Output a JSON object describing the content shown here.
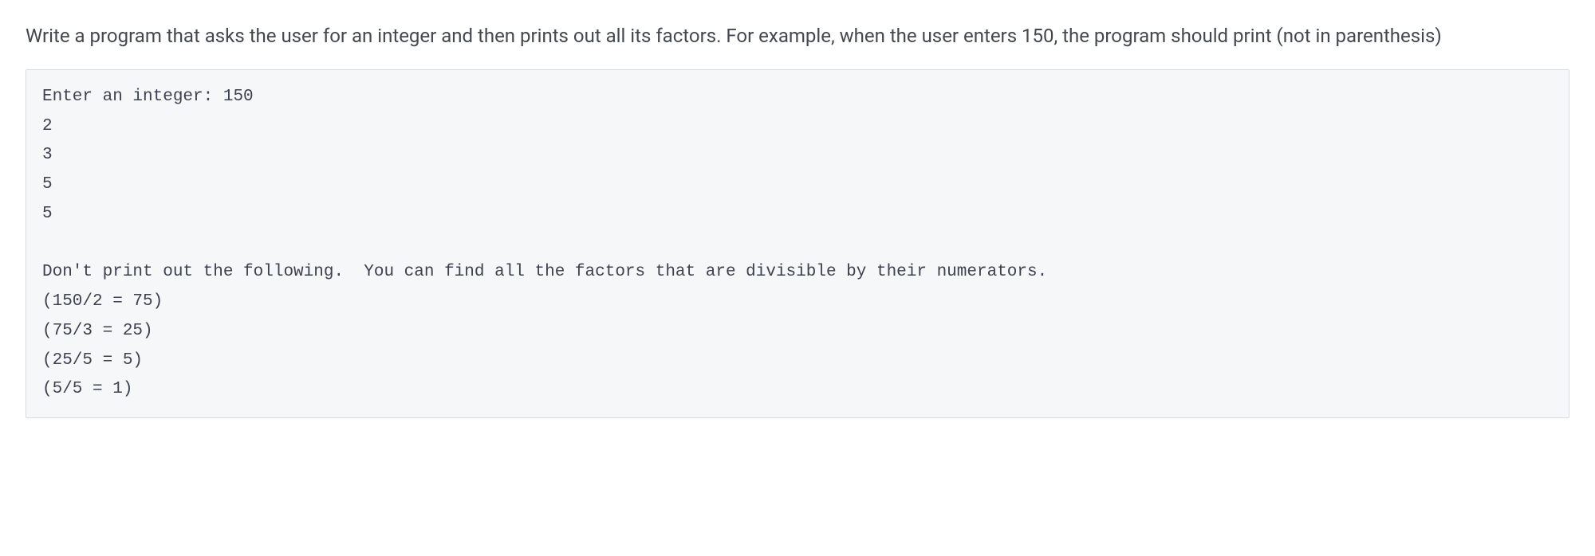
{
  "prompt": "Write a program that asks the user for an integer and then prints out all its factors. For example, when the user enters 150, the program should print (not in parenthesis)",
  "code": "Enter an integer: 150\n2\n3\n5\n5\n\nDon't print out the following.  You can find all the factors that are divisible by their numerators.\n(150/2 = 75)\n(75/3 = 25)\n(25/5 = 5)\n(5/5 = 1)"
}
